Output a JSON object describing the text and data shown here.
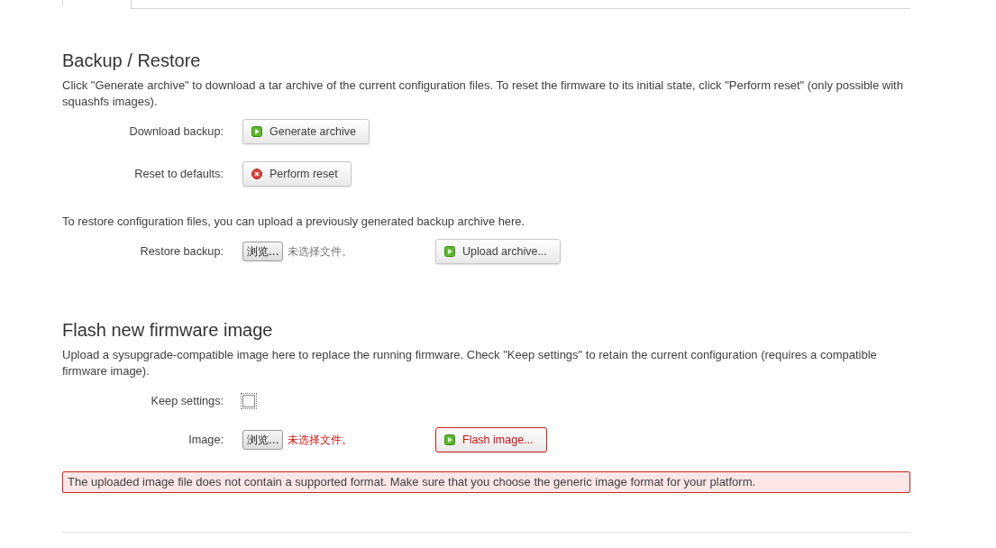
{
  "sections": [
    {
      "title": "Backup / Restore",
      "description": "Click \"Generate archive\" to download a tar archive of the current configuration files. To reset the firmware to its initial state, click \"Perform reset\" (only possible with squashfs images).",
      "rows": [
        {
          "kind": "button",
          "label": "Download backup:",
          "button": {
            "text": "Generate archive",
            "kind": "apply"
          }
        },
        {
          "kind": "button",
          "label": "Reset to defaults:",
          "button": {
            "text": "Perform reset",
            "kind": "reset"
          }
        },
        {
          "kind": "note",
          "text": "To restore configuration files, you can upload a previously generated backup archive here."
        },
        {
          "kind": "file",
          "label": "Restore backup:",
          "browse": "浏览...",
          "file_status": "未选择文件。",
          "invalid": false,
          "button": {
            "text": "Upload archive...",
            "kind": "apply"
          }
        }
      ]
    },
    {
      "title": "Flash new firmware image",
      "description": "Upload a sysupgrade-compatible image here to replace the running firmware. Check \"Keep settings\" to retain the current configuration (requires a compatible firmware image).",
      "rows": [
        {
          "kind": "checkbox",
          "label": "Keep settings:",
          "checked": false
        },
        {
          "kind": "file",
          "label": "Image:",
          "browse": "浏览...",
          "file_status": "未选择文件。",
          "invalid": true,
          "button": {
            "text": "Flash image...",
            "kind": "apply"
          }
        }
      ],
      "error": "The uploaded image file does not contain a supported format. Make sure that you choose the generic image format for your platform."
    }
  ]
}
